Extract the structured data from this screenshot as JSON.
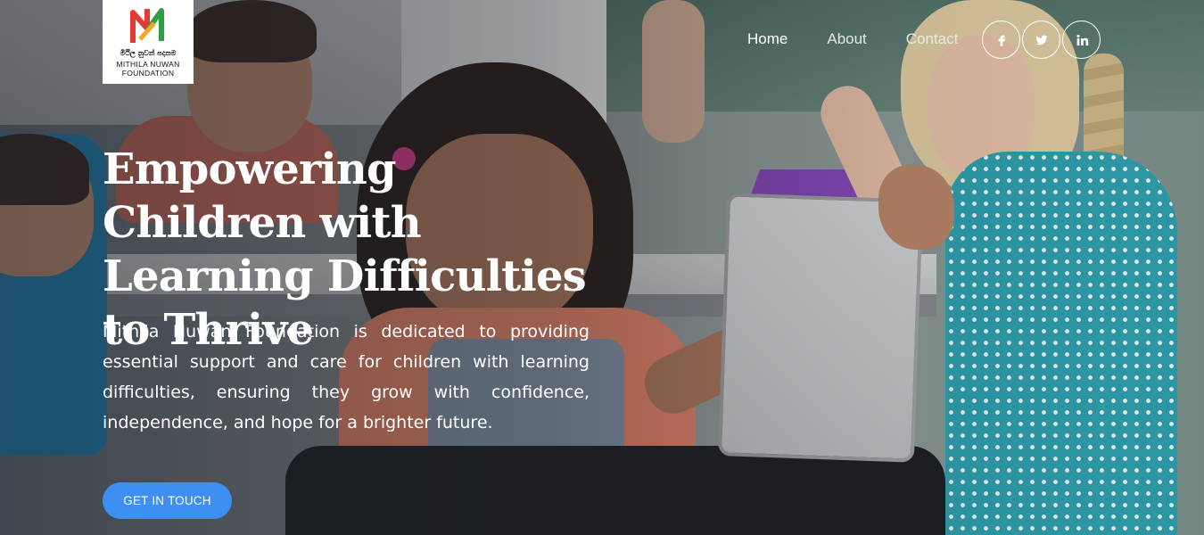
{
  "logo": {
    "sinhala": "මිථිල නුවන් පදනම",
    "line1": "MITHILA NUWAN",
    "line2": "FOUNDATION",
    "colors": {
      "red": "#e53935",
      "green": "#2e9e45",
      "orange": "#f5a623"
    }
  },
  "nav": {
    "items": [
      {
        "label": "Home",
        "active": true
      },
      {
        "label": "About",
        "active": false
      },
      {
        "label": "Contact",
        "active": false
      }
    ]
  },
  "social": [
    {
      "icon": "facebook-icon",
      "label": "f"
    },
    {
      "icon": "twitter-icon",
      "label": "twitter"
    },
    {
      "icon": "linkedin-icon",
      "label": "in"
    }
  ],
  "hero": {
    "headline": "Empowering Children with Learning Difficulties to Thrive",
    "description": "Mithila Nuwan Foundation is dedicated to providing essential support and care for children with learning difficulties, ensuring they grow with confidence, independence, and hope for a brighter future.",
    "cta_label": "GET IN TOUCH"
  },
  "colors": {
    "cta": "#3d8ff2",
    "text": "#ffffff"
  }
}
